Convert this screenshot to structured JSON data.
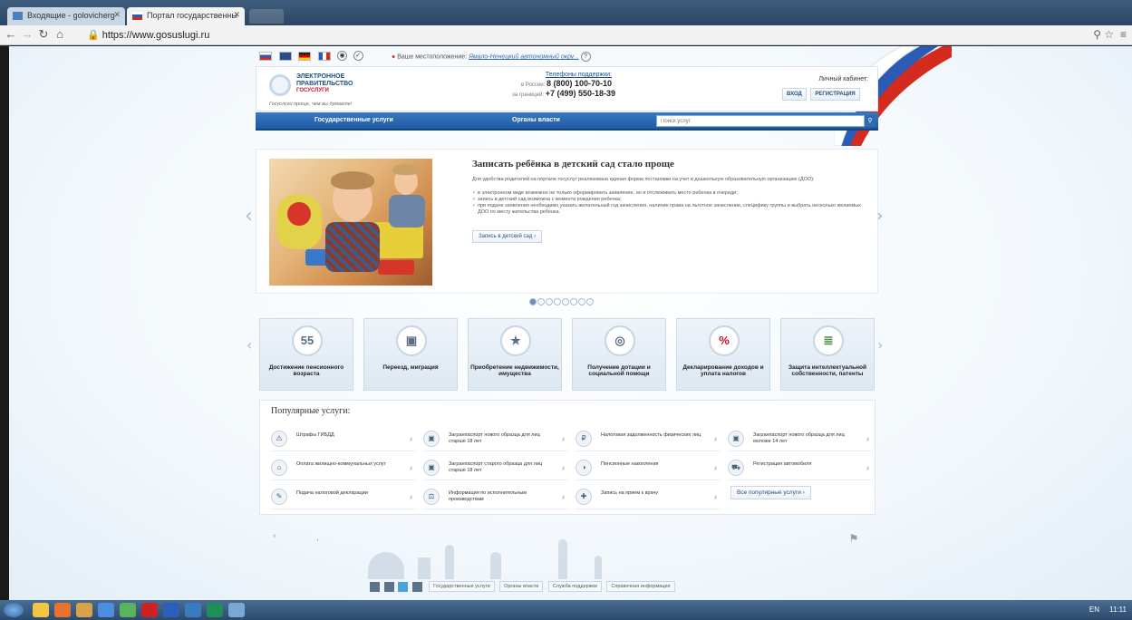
{
  "browser": {
    "tabs": [
      {
        "title": "Входящие - golovicherg",
        "active": false
      },
      {
        "title": "Портал государственны",
        "active": true
      }
    ],
    "url": "https://www.gosuslugi.ru",
    "zoom_icon": "zoom-icon",
    "star_icon": "star-icon",
    "menu_icon": "menu-icon"
  },
  "header": {
    "location_label": "Ваше местоположение:",
    "location_value": "Ямало-Ненецкий автономный окру...",
    "logo_line1": "ЭЛЕКТРОННОЕ ПРАВИТЕЛЬСТВО",
    "logo_line2": "ГОСУСЛУГИ",
    "logo_tagline": "Госуслуги проще, чем вы думаете!",
    "support_link": "Телефоны поддержки:",
    "phone_ru_label": "в России:",
    "phone_ru": "8 (800) 100-70-10",
    "phone_abroad_label": "за границей:",
    "phone_abroad": "+7 (499) 550-18-39",
    "cabinet_label": "Личный кабинет:",
    "login": "ВХОД",
    "register": "РЕГИСТРАЦИЯ",
    "nav": [
      "Государственные услуги",
      "Органы власти"
    ],
    "search_placeholder": "Поиск услуг"
  },
  "slide": {
    "title": "Записать ребёнка в детский сад стало проще",
    "intro": "Для удобства родителей на портале госуслуг реализована единая форма постановки на учет в дошкольную образовательную организацию (ДОО):",
    "bullets": [
      "в электронном виде возможно не только оформировать заявление, но и отслеживать место ребенка в очереди;",
      "запись в детский сад возможна с момента рождения ребенка;",
      "при подаче заявления необходимо указать желательный год зачисления, наличие права на льготное зачисление, специфику группы и выбрать несколько желаемых ДОО по месту жительства ребенка."
    ],
    "button": "Запись в детский сад",
    "dots_total": 8,
    "dots_active_index": 0
  },
  "categories": [
    {
      "label": "Достижение пенсионного возраста",
      "icon_text": "55",
      "icon": "pension-icon"
    },
    {
      "label": "Переезд, миграция",
      "icon_text": "▣",
      "icon": "passport-icon"
    },
    {
      "label": "Приобретение недвижимости, имущества",
      "icon_text": "★",
      "icon": "property-icon"
    },
    {
      "label": "Получение дотации и социальной помощи",
      "icon_text": "◎",
      "icon": "lifebuoy-icon"
    },
    {
      "label": "Декларирование доходов и уплата налогов",
      "icon_text": "%",
      "icon": "percent-icon"
    },
    {
      "label": "Защита интеллектуальной собственности, патенты",
      "icon_text": "≣",
      "icon": "certificate-icon"
    }
  ],
  "popular": {
    "title": "Популярные услуги:",
    "items": [
      {
        "label": "Штрафы ГИБДД",
        "icon": "traffic-light-icon",
        "glyph": "⚠"
      },
      {
        "label": "Загранпаспорт нового образца для лиц старше 18 лет",
        "icon": "passport-icon",
        "glyph": "▣"
      },
      {
        "label": "Налоговая задолженность физических лиц",
        "icon": "tax-icon",
        "glyph": "₽"
      },
      {
        "label": "Загранпаспорт нового образца для лиц моложе 14 лет",
        "icon": "passport-icon",
        "glyph": "▣"
      },
      {
        "label": "Оплата жилищно-коммунальных услуг",
        "icon": "utilities-icon",
        "glyph": "⌂"
      },
      {
        "label": "Загранпаспорт старого образца для лиц старше 18 лет",
        "icon": "passport-icon",
        "glyph": "▣"
      },
      {
        "label": "Пенсионные накопления",
        "icon": "pension-savings-icon",
        "glyph": "◑"
      },
      {
        "label": "Регистрация автомобиля",
        "icon": "car-icon",
        "glyph": "⛟"
      },
      {
        "label": "Подача налоговой декларации",
        "icon": "declaration-icon",
        "glyph": "✎"
      },
      {
        "label": "Информация по исполнительным производствам",
        "icon": "court-icon",
        "glyph": "⚖"
      },
      {
        "label": "Запись на прием к врачу",
        "icon": "doctor-icon",
        "glyph": "✚"
      }
    ],
    "all_button": "Все популярные услуги"
  },
  "footer": {
    "links": [
      "Государственные услуги",
      "Органы власти",
      "Служба поддержки",
      "Справочная информация"
    ],
    "social": [
      "vk-icon",
      "facebook-icon",
      "twitter-icon",
      "livejournal-icon"
    ]
  },
  "taskbar": {
    "lang": "EN",
    "clock": "11:11"
  },
  "colors": {
    "accent": "#1e5ba3",
    "brand_red": "#c8102e"
  }
}
